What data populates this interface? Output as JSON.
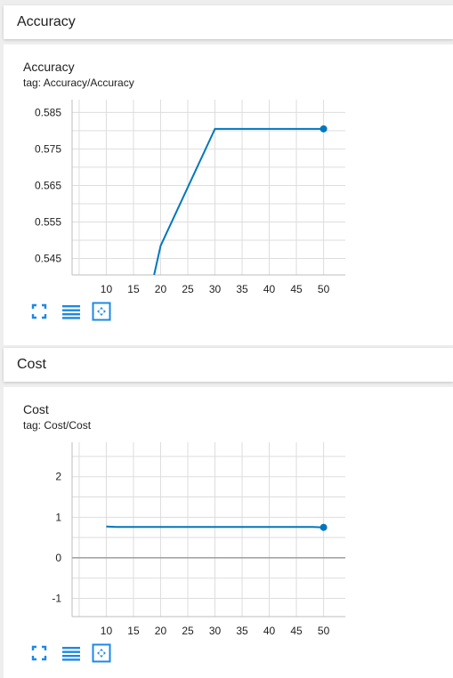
{
  "sections": [
    {
      "name": "Accuracy"
    },
    {
      "name": "Cost"
    }
  ],
  "cards": [
    {
      "title": "Accuracy",
      "tag": "tag: Accuracy/Accuracy"
    },
    {
      "title": "Cost",
      "tag": "tag: Cost/Cost"
    }
  ],
  "colors": {
    "series": "#0077bb",
    "grid": "#dddddd",
    "zero_line": "#9e9e9e",
    "icon": "#1e88e5"
  },
  "icons": [
    "expand-icon",
    "log-scale-icon",
    "fit-domain-icon"
  ],
  "chart_data": [
    {
      "type": "line",
      "title": "Accuracy",
      "xlabel": "",
      "ylabel": "",
      "xlim": [
        3.7,
        54
      ],
      "ylim": [
        0.5405,
        0.5885
      ],
      "xticks": [
        10,
        15,
        20,
        25,
        30,
        35,
        40,
        45,
        50
      ],
      "yticks": [
        0.545,
        0.555,
        0.565,
        0.575,
        0.585
      ],
      "ytick_labels": [
        "0.545",
        "0.555",
        "0.565",
        "0.575",
        "0.585"
      ],
      "grid": true,
      "series": [
        {
          "x": [
            18.8,
            20,
            30,
            40,
            50
          ],
          "y": [
            0.5405,
            0.5485,
            0.5805,
            0.5805,
            0.5805
          ]
        }
      ]
    },
    {
      "type": "line",
      "title": "Cost",
      "xlabel": "",
      "ylabel": "",
      "xlim": [
        3.7,
        54
      ],
      "ylim": [
        -1.45,
        2.85
      ],
      "xticks": [
        10,
        15,
        20,
        25,
        30,
        35,
        40,
        45,
        50
      ],
      "yticks": [
        -1,
        0,
        1,
        2
      ],
      "ytick_labels": [
        "-1",
        "0",
        "1",
        "2"
      ],
      "grid": true,
      "series": [
        {
          "x": [
            10,
            12,
            20,
            30,
            40,
            48,
            50
          ],
          "y": [
            0.77,
            0.76,
            0.76,
            0.76,
            0.76,
            0.76,
            0.75
          ]
        }
      ]
    }
  ]
}
